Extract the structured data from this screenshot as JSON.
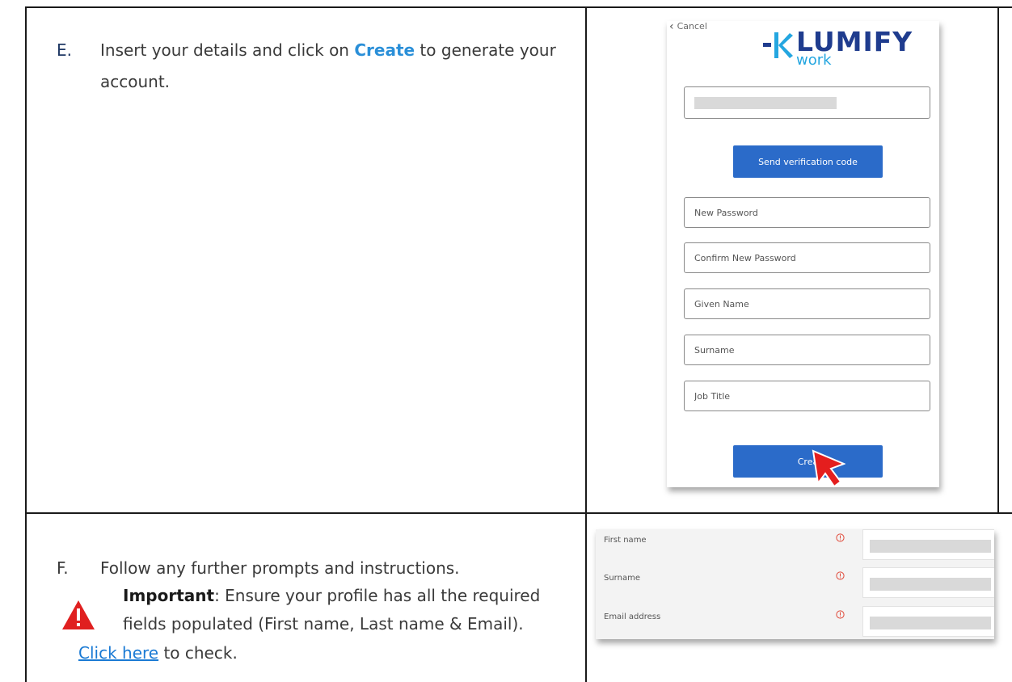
{
  "step_e": {
    "letter": "E.",
    "text_before": "Insert your details and click on ",
    "text_strong": "Create",
    "text_after": " to generate your account."
  },
  "signup_form": {
    "cancel_label": "Cancel",
    "logo_main": "LUMIFY",
    "logo_sub": "work",
    "send_button": "Send verification code",
    "fields": [
      {
        "placeholder": "New Password"
      },
      {
        "placeholder": "Confirm New Password"
      },
      {
        "placeholder": "Given Name"
      },
      {
        "placeholder": "Surname"
      },
      {
        "placeholder": "Job Title"
      }
    ],
    "create_button": "Crea"
  },
  "step_f": {
    "letter": "F.",
    "text": "Follow any further prompts and instructions.",
    "important_label": "Important",
    "important_text": ": Ensure your profile has all the required fields populated (First name, Last name & Email).",
    "link_text": "Click here",
    "after_link": " to check."
  },
  "profile_form": {
    "rows": [
      {
        "label": "First name"
      },
      {
        "label": "Surname"
      },
      {
        "label": "Email address"
      }
    ]
  },
  "colors": {
    "brand_blue": "#2b6bc9",
    "logo_navy": "#1f3c8e",
    "logo_cyan": "#24a6e0",
    "warning_red": "#e02020"
  }
}
